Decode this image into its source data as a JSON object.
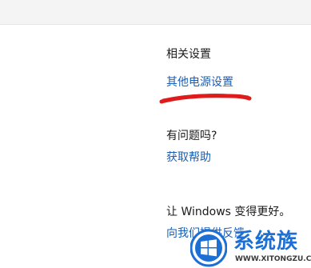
{
  "related_settings": {
    "heading": "相关设置",
    "other_power_settings_link": "其他电源设置"
  },
  "help": {
    "heading": "有问题吗?",
    "get_help_link": "获取帮助"
  },
  "feedback": {
    "heading": "让 Windows 变得更好。",
    "give_feedback_link": "向我们提供反馈"
  },
  "watermark": {
    "brand": "系统族",
    "url": "WWW.XITONGZU.COM"
  },
  "colors": {
    "link": "#1a5fb4",
    "annotation": "#e01b1b",
    "watermark": "#1d6fd4"
  }
}
